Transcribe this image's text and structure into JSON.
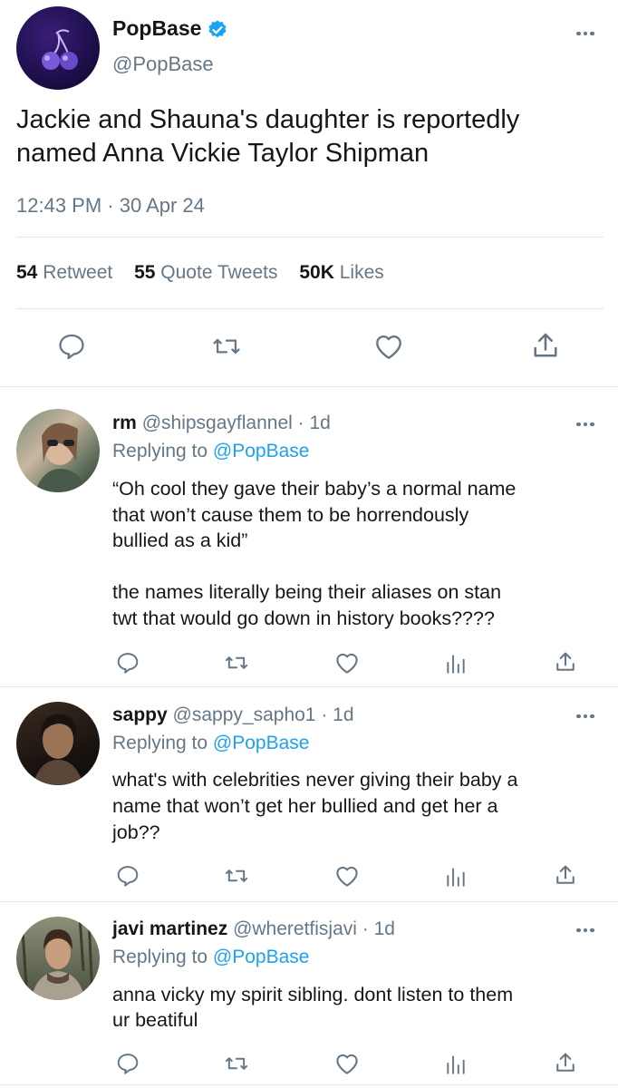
{
  "main_tweet": {
    "display_name": "PopBase",
    "handle": "@PopBase",
    "text_line1": "Jackie and Shauna's daughter is reportedly",
    "text_line2": "named Anna Vickie Taylor Shipman",
    "timestamp": "12:43 PM · 30 Apr 24",
    "stats": {
      "retweets_count": "54",
      "retweets_label": "Retweet",
      "quotes_count": "55",
      "quotes_label": "Quote Tweets",
      "likes_count": "50K",
      "likes_label": "Likes"
    }
  },
  "replies": [
    {
      "display_name": "rm",
      "handle": "@shipsgayflannel",
      "age": "· 1d",
      "replying_prefix": "Replying to",
      "replying_handle": "@PopBase",
      "lines": [
        "“Oh cool they gave their baby’s a normal name",
        "that won’t cause them to be horrendously",
        "bullied as a kid”",
        "",
        "the names literally being their aliases on stan",
        "twt that would go down in history books????"
      ]
    },
    {
      "display_name": "sappy",
      "handle": "@sappy_sapho1",
      "age": "· 1d",
      "replying_prefix": "Replying to",
      "replying_handle": "@PopBase",
      "lines": [
        "what's with celebrities never giving their baby a",
        "name that won’t get her bullied and get her a",
        "job??"
      ]
    },
    {
      "display_name": "javi martinez",
      "handle": "@wheretfisjavi",
      "age": "· 1d",
      "replying_prefix": "Replying to",
      "replying_handle": "@PopBase",
      "lines": [
        "anna vicky my spirit sibling. dont listen to them",
        "ur beatiful"
      ]
    }
  ],
  "colors": {
    "accent": "#1da1f2",
    "muted": "#657786",
    "separator": "#e1e8ed",
    "verified": "#1da1f2"
  },
  "icons": [
    "reply-icon",
    "retweet-icon",
    "like-icon",
    "views-icon",
    "share-icon",
    "more-icon",
    "verified-badge-icon",
    "cherry-logo-icon"
  ]
}
